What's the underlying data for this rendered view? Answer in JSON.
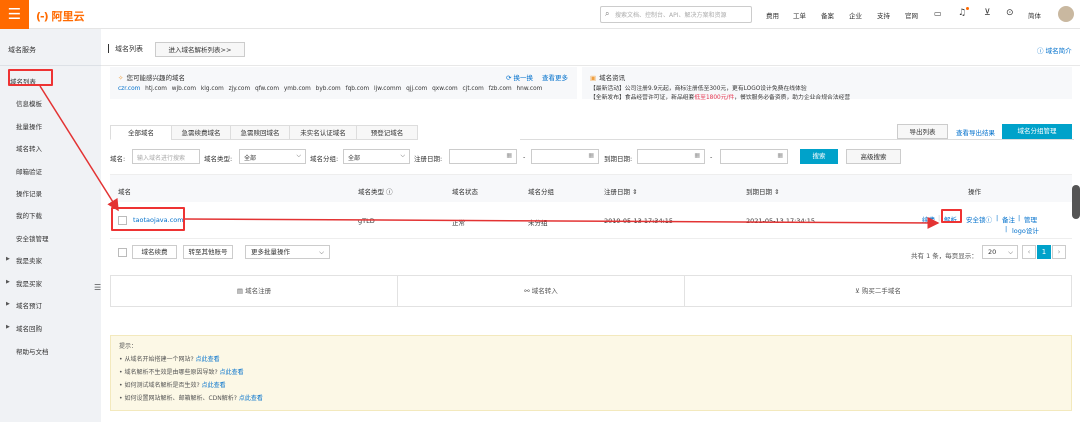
{
  "topbar": {
    "logo": "阿里云",
    "search_placeholder": "搜索文档、控制台、API、解决方案和资源",
    "nav": [
      "费用",
      "工单",
      "备案",
      "企业",
      "支持",
      "官网"
    ],
    "lang": "简体"
  },
  "sidebar": {
    "title": "域名服务",
    "items": [
      "域名列表",
      "信息模板",
      "批量操作",
      "域名转入",
      "邮箱验证",
      "操作记录",
      "我的下载",
      "安全锁管理"
    ],
    "groups": [
      "我是卖家",
      "我是买家",
      "域名预订",
      "域名回购"
    ],
    "help": "帮助与文档"
  },
  "main": {
    "title": "域名列表",
    "enter_parse": "进入域名解析列表>>",
    "help_link": "域名简介",
    "interest": {
      "title": "您可能感兴趣的域名",
      "refresh": "换一换",
      "more": "查看更多",
      "domains": [
        "czr.com",
        "htj.com",
        "wjb.com",
        "klg.com",
        "zjy.com",
        "qfw.com",
        "ymb.com",
        "byb.com",
        "fqb.com",
        "ljw.comm",
        "qjj.com",
        "qxw.com",
        "cjt.com",
        "fzb.com",
        "hnw.com"
      ]
    },
    "news": {
      "title": "域名资讯",
      "line1": "【最新活动】公司注册9.9元起，商标注册低至300元，更有LOGO设计免费在线体验",
      "line2_a": "【全新发布】食品经营许可证，新品组套",
      "line2_b": "低至1800元/件",
      "line2_c": "，餐饮服务必备资质，助力企业合规合法经营"
    },
    "tabs": [
      "全部域名",
      "急需续费域名",
      "急需赎回域名",
      "未实名认证域名",
      "预登记域名"
    ],
    "export_label": "导出列表",
    "export_result": "查看导出结果",
    "group_manage": "域名分组管理",
    "filters": {
      "domain_label": "域名:",
      "domain_placeholder": "输入域名进行搜索",
      "type_label": "域名类型:",
      "type_value": "全部",
      "group_label": "域名分组:",
      "group_value": "全部",
      "reg_label": "注册日期:",
      "exp_label": "到期日期:",
      "dash": "-",
      "search": "搜索",
      "advanced": "高级搜索"
    },
    "table": {
      "headers": [
        "域名",
        "域名类型",
        "域名状态",
        "域名分组",
        "注册日期",
        "到期日期",
        "操作"
      ],
      "row": {
        "domain": "taotaojava.com",
        "type": "gTLD",
        "status": "正常",
        "group": "未分组",
        "reg": "2019-05-13 17:34:15",
        "exp": "2021-05-13 17:34:15",
        "ops": [
          "续费",
          "解析",
          "安全锁",
          "备注",
          "管理",
          "logo设计"
        ]
      }
    },
    "footer": {
      "renew": "域名续费",
      "transfer": "转至其他账号",
      "bulk": "更多批量操作",
      "pager_text": "共有 1 条，每页显示：",
      "page_size": "20",
      "page": "1"
    },
    "quick": [
      "域名注册",
      "域名转入",
      "购买二手域名"
    ],
    "tips": {
      "title": "提示：",
      "items": [
        {
          "text": "• 从域名开始搭建一个网站?",
          "link": "点此查看"
        },
        {
          "text": "• 域名解析不生效是由哪些原因导致?",
          "link": "点此查看"
        },
        {
          "text": "• 如何测试域名解析是否生效?",
          "link": "点此查看"
        },
        {
          "text": "• 如何设置网站解析、邮箱解析、CDN解析?",
          "link": "点此查看"
        }
      ]
    }
  },
  "colors": {
    "brand": "#ff6a00",
    "primary": "#00a2ca",
    "link": "#0070cc",
    "annotation": "#e33333"
  }
}
